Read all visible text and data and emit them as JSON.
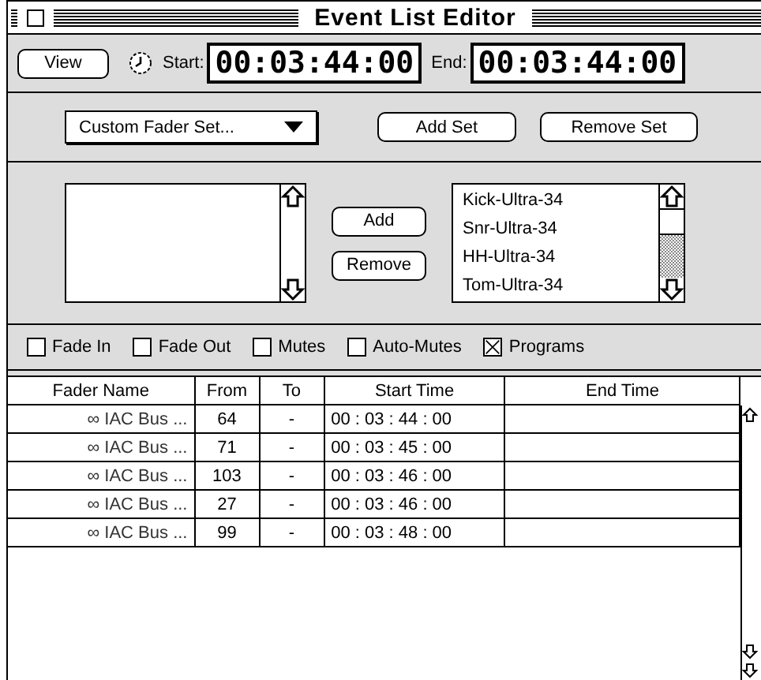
{
  "window": {
    "title": "Event List Editor"
  },
  "toolbar": {
    "view_button": "View",
    "start_label": "Start:",
    "start_time": "00:03:44:00",
    "end_label": "End:",
    "end_time": "00:03:44:00"
  },
  "fader_set": {
    "popup": "Custom Fader Set...",
    "buttons": [
      "Add Set",
      "Remove Set"
    ]
  },
  "move_buttons": [
    "Add",
    "Remove"
  ],
  "right_list": {
    "items": [
      "Kick-Ultra-34",
      "Snr-Ultra-34",
      "HH-Ultra-34",
      "Tom-Ultra-34"
    ]
  },
  "filters": [
    {
      "label": "Fade In",
      "checked": false
    },
    {
      "label": "Fade Out",
      "checked": false
    },
    {
      "label": "Mutes",
      "checked": false
    },
    {
      "label": "Auto-Mutes",
      "checked": false
    },
    {
      "label": "Programs",
      "checked": true
    }
  ],
  "table": {
    "columns": [
      "Fader Name",
      "From",
      "To",
      "Start Time",
      "End Time"
    ],
    "rows": [
      [
        "∞ IAC Bus ...",
        "64",
        "-",
        "00 : 03 : 44 : 00",
        ""
      ],
      [
        "∞ IAC Bus ...",
        "71",
        "-",
        "00 : 03 : 45 : 00",
        ""
      ],
      [
        "∞ IAC Bus ...",
        "103",
        "-",
        "00 : 03 : 46 : 00",
        ""
      ],
      [
        "∞ IAC Bus ...",
        "27",
        "-",
        "00 : 03 : 46 : 00",
        ""
      ],
      [
        "∞ IAC Bus ...",
        "99",
        "-",
        "00 : 03 : 48 : 00",
        ""
      ]
    ]
  }
}
